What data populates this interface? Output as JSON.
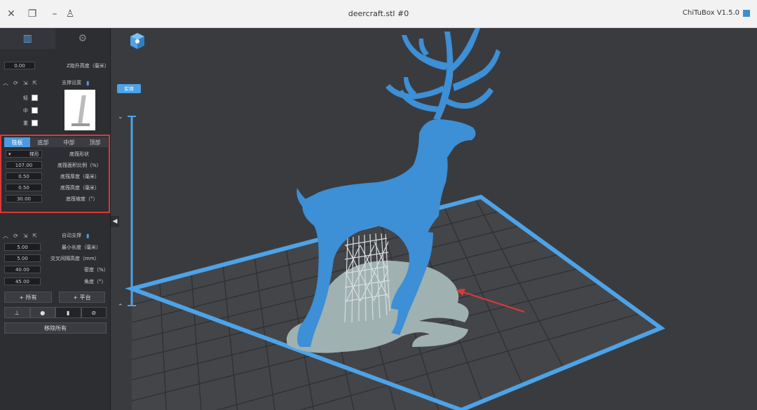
{
  "window": {
    "title": "deercraft.stl #0",
    "app_name": "ChiTuBox V1.5.0",
    "close_glyph": "✕",
    "restore_glyph": "❐",
    "minimize_glyph": "–",
    "user_glyph": "♙"
  },
  "panel": {
    "tabs": [
      {
        "icon": "support-tower-icon",
        "glyph": "▥"
      },
      {
        "icon": "gear-icon",
        "glyph": "⚙"
      }
    ],
    "z_lift": {
      "label": "Z抬升高度（毫米）",
      "value": "0.00"
    },
    "support_settings": {
      "title": "支撑设置",
      "density_labels": [
        "轻",
        "中",
        "重"
      ]
    },
    "raft": {
      "tabs": [
        "顶部",
        "中部",
        "底部",
        "筏板"
      ],
      "active_tab": 3,
      "shape_label": "底筏形状",
      "shape_value": "梯形",
      "fields": [
        {
          "label": "底筏面积比例（%）",
          "value": "107.00"
        },
        {
          "label": "底筏厚度（毫米）",
          "value": "0.50"
        },
        {
          "label": "底筏高度（毫米）",
          "value": "0.50"
        },
        {
          "label": "底筏坡度（°）",
          "value": "30.00"
        }
      ]
    },
    "auto_support": {
      "title": "自动支撑",
      "fields": [
        {
          "label": "最小长度（毫米）",
          "value": "5.00"
        },
        {
          "label": "交叉间隔高度（mm）",
          "value": "5.00"
        },
        {
          "label": "密度（%）",
          "value": "40.00"
        },
        {
          "label": "角度（°）",
          "value": "45.00"
        }
      ],
      "all_button": "+ 所有",
      "platform_button": "+ 平台",
      "remove_all_button": "移除所有"
    }
  },
  "viewport": {
    "layer_button": "实体",
    "accent": "#4da3e8",
    "model_color": "#3d8fd6",
    "raft_color": "#9fb1b1"
  }
}
